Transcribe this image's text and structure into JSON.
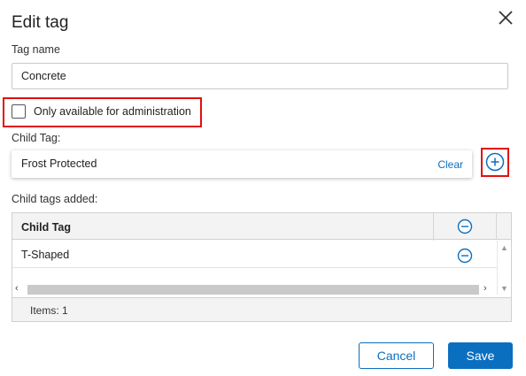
{
  "dialog": {
    "title": "Edit tag",
    "close_icon": "close-icon"
  },
  "tag_name": {
    "label": "Tag name",
    "value": "Concrete"
  },
  "admin_only": {
    "label": "Only available for administration",
    "checked": false
  },
  "child_tag": {
    "label": "Child Tag:",
    "value": "Frost Protected",
    "clear_label": "Clear",
    "add_icon": "plus-circle-icon"
  },
  "child_tags_added": {
    "label": "Child tags added:",
    "column_header": "Child Tag",
    "remove_icon": "minus-circle-icon",
    "rows": [
      {
        "name": "T-Shaped"
      }
    ],
    "items_count": "Items: 1"
  },
  "actions": {
    "cancel_label": "Cancel",
    "save_label": "Save"
  },
  "colors": {
    "accent": "#0b6fc0",
    "highlight": "#e01010"
  }
}
